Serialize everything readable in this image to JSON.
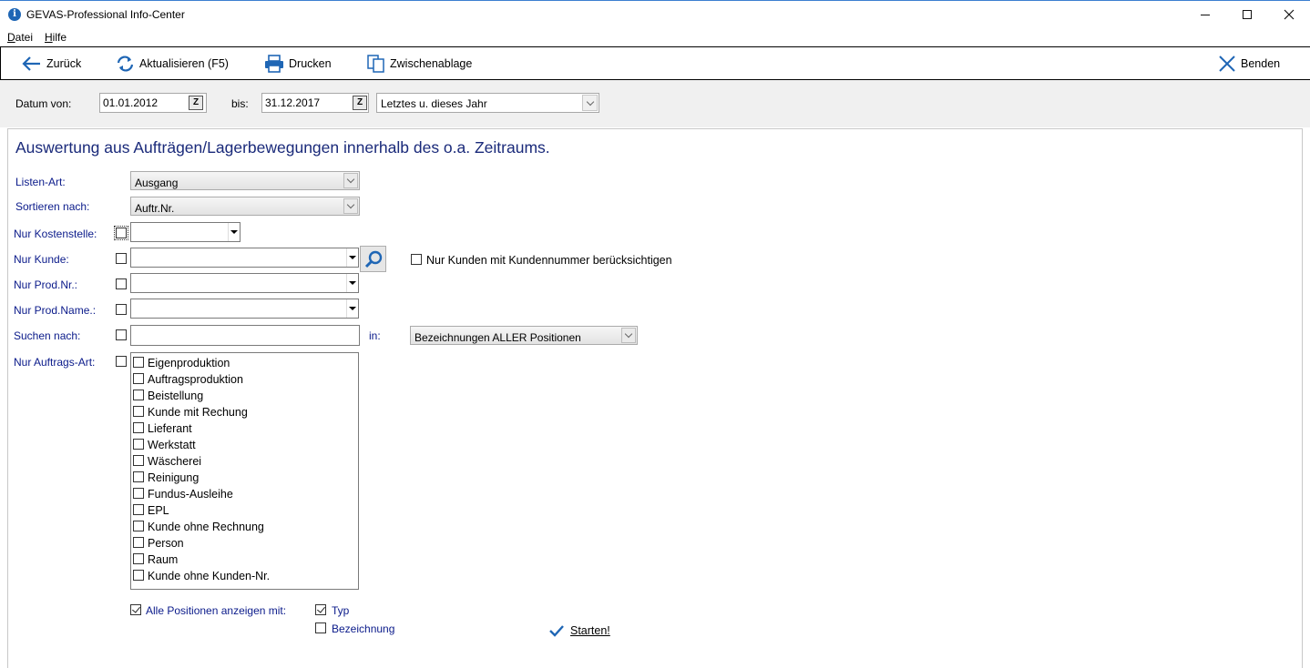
{
  "window": {
    "title": "GEVAS-Professional Info-Center",
    "app_icon_glyph": "i"
  },
  "menu": [
    "Datei",
    "Hilfe"
  ],
  "toolbar": {
    "back": "Zurück",
    "refresh": "Aktualisieren (F5)",
    "print": "Drucken",
    "clipboard": "Zwischenablage",
    "exit": "Benden"
  },
  "dates": {
    "from_label": "Datum von:",
    "from_value": "01.01.2012",
    "to_label": "bis:",
    "to_value": "31.12.2017",
    "calendar_glyph": "Z",
    "range_value": "Letztes u. dieses Jahr"
  },
  "form": {
    "heading": "Auswertung aus Aufträgen/Lagerbewegungen innerhalb des o.a. Zeitraums.",
    "listen_art_label": "Listen-Art:",
    "listen_art_value": "Ausgang",
    "sortieren_label": "Sortieren nach:",
    "sortieren_value": "Auftr.Nr.",
    "kostenstelle_label": "Nur Kostenstelle:",
    "kunde_label": "Nur Kunde:",
    "kundennummer_label": "Nur Kunden mit Kundennummer berücksichtigen",
    "prodnr_label": "Nur Prod.Nr.:",
    "prodname_label": "Nur Prod.Name.:",
    "suchen_label": "Suchen nach:",
    "in_label": "in:",
    "in_value": "Bezeichnungen ALLER Positionen",
    "auftragsart_label": "Nur Auftrags-Art:",
    "auftragsarten": [
      "Eigenproduktion",
      "Auftragsproduktion",
      "Beistellung",
      "Kunde mit Rechung",
      "Lieferant",
      "Werkstatt",
      "Wäscherei",
      "Reinigung",
      "Fundus-Ausleihe",
      "EPL",
      "Kunde ohne Rechnung",
      "Person",
      "Raum",
      "Kunde ohne Kunden-Nr."
    ],
    "alle_positionen_label": "Alle Positionen anzeigen mit:",
    "typ_label": "Typ",
    "bezeichnung_label": "Bezeichnung",
    "start_label": "Starten!"
  },
  "colors": {
    "label_blue": "#0a1a8a",
    "heading_blue": "#1a2a7a",
    "icon_blue": "#1f66b5"
  }
}
